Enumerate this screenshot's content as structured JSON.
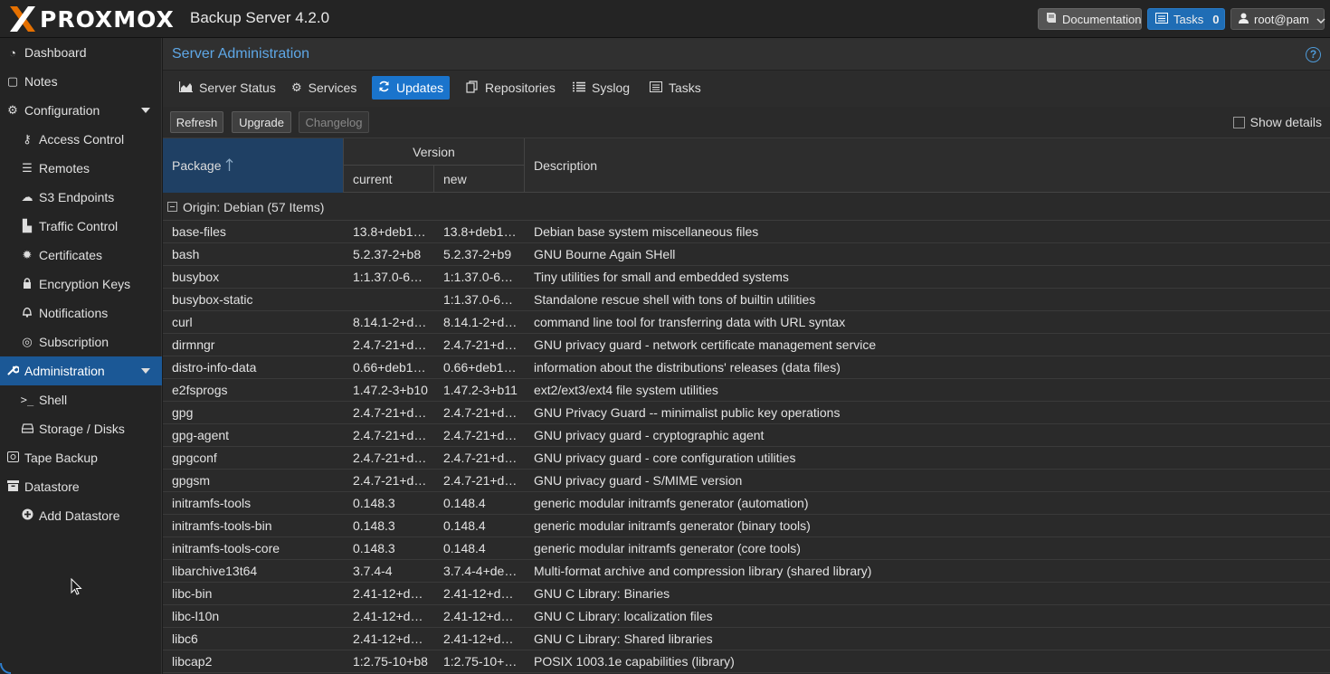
{
  "header": {
    "brand": "PROXMOX",
    "product": "Backup Server 4.2.0",
    "documentation_label": "Documentation",
    "tasks_label": "Tasks",
    "tasks_count": "0",
    "user_label": "root@pam"
  },
  "sidebar": {
    "items": [
      {
        "label": "Dashboard",
        "icon": "dashboard-icon"
      },
      {
        "label": "Notes",
        "icon": "notes-icon"
      },
      {
        "label": "Configuration",
        "icon": "gears-icon"
      },
      {
        "label": "Access Control",
        "icon": "key-icon"
      },
      {
        "label": "Remotes",
        "icon": "server-icon"
      },
      {
        "label": "S3 Endpoints",
        "icon": "cloud-upload-icon"
      },
      {
        "label": "Traffic Control",
        "icon": "bar-chart-icon"
      },
      {
        "label": "Certificates",
        "icon": "certificate-icon"
      },
      {
        "label": "Encryption Keys",
        "icon": "lock-icon"
      },
      {
        "label": "Notifications",
        "icon": "bell-icon"
      },
      {
        "label": "Subscription",
        "icon": "support-icon"
      },
      {
        "label": "Administration",
        "icon": "wrench-icon"
      },
      {
        "label": "Shell",
        "icon": "terminal-icon"
      },
      {
        "label": "Storage / Disks",
        "icon": "hdd-icon"
      },
      {
        "label": "Tape Backup",
        "icon": "tape-icon"
      },
      {
        "label": "Datastore",
        "icon": "archive-icon"
      },
      {
        "label": "Add Datastore",
        "icon": "plus-circle-icon"
      }
    ]
  },
  "panel": {
    "title": "Server Administration",
    "tabs": [
      {
        "label": "Server Status",
        "icon": "area-chart-icon"
      },
      {
        "label": "Services",
        "icon": "cogs-icon"
      },
      {
        "label": "Updates",
        "icon": "refresh-icon"
      },
      {
        "label": "Repositories",
        "icon": "files-icon"
      },
      {
        "label": "Syslog",
        "icon": "list-icon"
      },
      {
        "label": "Tasks",
        "icon": "list-alt-icon"
      }
    ],
    "active_tab": "Updates"
  },
  "toolbar": {
    "refresh_label": "Refresh",
    "upgrade_label": "Upgrade",
    "changelog_label": "Changelog",
    "show_details_label": "Show details"
  },
  "grid": {
    "columns": {
      "package": "Package",
      "version": "Version",
      "current": "current",
      "new": "new",
      "description": "Description"
    },
    "group_label": "Origin: Debian (57 Items)",
    "rows": [
      {
        "package": "base-files",
        "current": "13.8+deb1…",
        "new": "13.8+deb1…",
        "description": "Debian base system miscellaneous files"
      },
      {
        "package": "bash",
        "current": "5.2.37-2+b8",
        "new": "5.2.37-2+b9",
        "description": "GNU Bourne Again SHell"
      },
      {
        "package": "busybox",
        "current": "1:1.37.0-6…",
        "new": "1:1.37.0-6…",
        "description": "Tiny utilities for small and embedded systems"
      },
      {
        "package": "busybox-static",
        "current": "",
        "new": "1:1.37.0-6…",
        "description": "Standalone rescue shell with tons of builtin utilities"
      },
      {
        "package": "curl",
        "current": "8.14.1-2+d…",
        "new": "8.14.1-2+d…",
        "description": "command line tool for transferring data with URL syntax"
      },
      {
        "package": "dirmngr",
        "current": "2.4.7-21+d…",
        "new": "2.4.7-21+d…",
        "description": "GNU privacy guard - network certificate management service"
      },
      {
        "package": "distro-info-data",
        "current": "0.66+deb1…",
        "new": "0.66+deb1…",
        "description": "information about the distributions' releases (data files)"
      },
      {
        "package": "e2fsprogs",
        "current": "1.47.2-3+b10",
        "new": "1.47.2-3+b11",
        "description": "ext2/ext3/ext4 file system utilities"
      },
      {
        "package": "gpg",
        "current": "2.4.7-21+d…",
        "new": "2.4.7-21+d…",
        "description": "GNU Privacy Guard -- minimalist public key operations"
      },
      {
        "package": "gpg-agent",
        "current": "2.4.7-21+d…",
        "new": "2.4.7-21+d…",
        "description": "GNU privacy guard - cryptographic agent"
      },
      {
        "package": "gpgconf",
        "current": "2.4.7-21+d…",
        "new": "2.4.7-21+d…",
        "description": "GNU privacy guard - core configuration utilities"
      },
      {
        "package": "gpgsm",
        "current": "2.4.7-21+d…",
        "new": "2.4.7-21+d…",
        "description": "GNU privacy guard - S/MIME version"
      },
      {
        "package": "initramfs-tools",
        "current": "0.148.3",
        "new": "0.148.4",
        "description": "generic modular initramfs generator (automation)"
      },
      {
        "package": "initramfs-tools-bin",
        "current": "0.148.3",
        "new": "0.148.4",
        "description": "generic modular initramfs generator (binary tools)"
      },
      {
        "package": "initramfs-tools-core",
        "current": "0.148.3",
        "new": "0.148.4",
        "description": "generic modular initramfs generator (core tools)"
      },
      {
        "package": "libarchive13t64",
        "current": "3.7.4-4",
        "new": "3.7.4-4+de…",
        "description": "Multi-format archive and compression library (shared library)"
      },
      {
        "package": "libc-bin",
        "current": "2.41-12+d…",
        "new": "2.41-12+d…",
        "description": "GNU C Library: Binaries"
      },
      {
        "package": "libc-l10n",
        "current": "2.41-12+d…",
        "new": "2.41-12+d…",
        "description": "GNU C Library: localization files"
      },
      {
        "package": "libc6",
        "current": "2.41-12+d…",
        "new": "2.41-12+d…",
        "description": "GNU C Library: Shared libraries"
      },
      {
        "package": "libcap2",
        "current": "1:2.75-10+b8",
        "new": "1:2.75-10+…",
        "description": "POSIX 1003.1e capabilities (library)"
      }
    ]
  },
  "colors": {
    "accent": "#1a74cc",
    "logo_orange": "#e57000",
    "title_blue": "#5ea7e6"
  }
}
